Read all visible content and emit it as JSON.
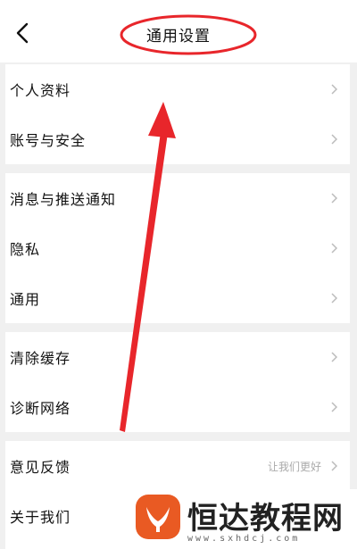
{
  "header": {
    "title": "通用设置"
  },
  "groups": [
    {
      "items": [
        {
          "label": "个人资料"
        },
        {
          "label": "账号与安全"
        }
      ]
    },
    {
      "items": [
        {
          "label": "消息与推送通知"
        },
        {
          "label": "隐私"
        },
        {
          "label": "通用"
        }
      ]
    },
    {
      "items": [
        {
          "label": "清除缓存"
        },
        {
          "label": "诊断网络"
        }
      ]
    },
    {
      "items": [
        {
          "label": "意见反馈",
          "hint": "让我们更好"
        },
        {
          "label": "关于我们"
        }
      ]
    }
  ],
  "watermark": {
    "brand": "恒达教程网",
    "url": "www.sxhdcj.com"
  },
  "colors": {
    "annotation": "#e8262b",
    "logo": "#e95a23"
  }
}
